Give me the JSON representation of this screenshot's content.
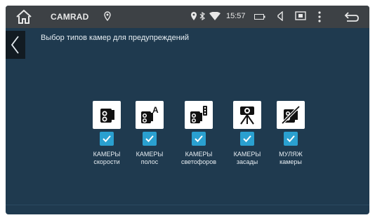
{
  "statusbar": {
    "app_name": "CAMRAD",
    "time": "15:57"
  },
  "page": {
    "title": "Выбор типов камер для предупреждений"
  },
  "camera_types": [
    {
      "line1": "КАМЕРЫ",
      "line2": "скорости",
      "checked": true,
      "icon": "speed-camera-icon"
    },
    {
      "line1": "КАМЕРЫ",
      "line2": "полос",
      "checked": true,
      "icon": "lane-camera-icon"
    },
    {
      "line1": "КАМЕРЫ",
      "line2": "светофоров",
      "checked": true,
      "icon": "traffic-light-camera-icon"
    },
    {
      "line1": "КАМЕРЫ",
      "line2": "засады",
      "checked": true,
      "icon": "ambush-camera-icon"
    },
    {
      "line1": "МУЛЯЖ",
      "line2": "камеры",
      "checked": true,
      "icon": "dummy-camera-icon"
    }
  ],
  "colors": {
    "background": "#1f3a4f",
    "statusbar": "#3d4145",
    "checkbox": "#2aa0d0"
  }
}
